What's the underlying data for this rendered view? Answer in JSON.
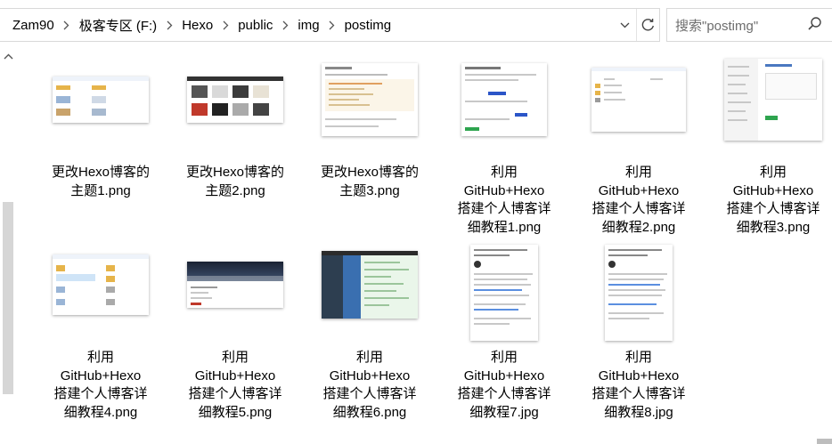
{
  "breadcrumb": [
    "Zam90",
    "极客专区 (F:)",
    "Hexo",
    "public",
    "img",
    "postimg"
  ],
  "search": {
    "placeholder": "搜索\"postimg\""
  },
  "files": [
    {
      "name": "更改Hexo博客的主题1.png",
      "lines": [
        "更改Hexo博客的",
        "主题1.png"
      ]
    },
    {
      "name": "更改Hexo博客的主题2.png",
      "lines": [
        "更改Hexo博客的",
        "主题2.png"
      ]
    },
    {
      "name": "更改Hexo博客的主题3.png",
      "lines": [
        "更改Hexo博客的",
        "主题3.png"
      ]
    },
    {
      "name": "利用GitHub+Hexo搭建个人博客详细教程1.png",
      "lines": [
        "利用",
        "GitHub+Hexo",
        "搭建个人博客详",
        "细教程1.png"
      ]
    },
    {
      "name": "利用GitHub+Hexo搭建个人博客详细教程2.png",
      "lines": [
        "利用",
        "GitHub+Hexo",
        "搭建个人博客详",
        "细教程2.png"
      ]
    },
    {
      "name": "利用GitHub+Hexo搭建个人博客详细教程3.png",
      "lines": [
        "利用",
        "GitHub+Hexo",
        "搭建个人博客详",
        "细教程3.png"
      ]
    },
    {
      "name": "利用GitHub+Hexo搭建个人博客详细教程4.png",
      "lines": [
        "利用",
        "GitHub+Hexo",
        "搭建个人博客详",
        "细教程4.png"
      ]
    },
    {
      "name": "利用GitHub+Hexo搭建个人博客详细教程5.png",
      "lines": [
        "利用",
        "GitHub+Hexo",
        "搭建个人博客详",
        "细教程5.png"
      ]
    },
    {
      "name": "利用GitHub+Hexo搭建个人博客详细教程6.png",
      "lines": [
        "利用",
        "GitHub+Hexo",
        "搭建个人博客详",
        "细教程6.png"
      ]
    },
    {
      "name": "利用GitHub+Hexo搭建个人博客详细教程7.jpg",
      "lines": [
        "利用",
        "GitHub+Hexo",
        "搭建个人博客详",
        "细教程7.jpg"
      ]
    },
    {
      "name": "利用GitHub+Hexo搭建个人博客详细教程8.jpg",
      "lines": [
        "利用",
        "GitHub+Hexo",
        "搭建个人博客详",
        "细教程8.jpg"
      ]
    }
  ],
  "icons": {
    "separator": "chevron-right-icon",
    "dropdown": "chevron-down-icon",
    "refresh": "refresh-icon",
    "search": "search-icon",
    "scroll_up": "chevron-up-icon"
  },
  "colors": {
    "border": "#d9d9d9",
    "scroll_thumb": "#d6d6d6",
    "placeholder": "#6d6d6d"
  }
}
